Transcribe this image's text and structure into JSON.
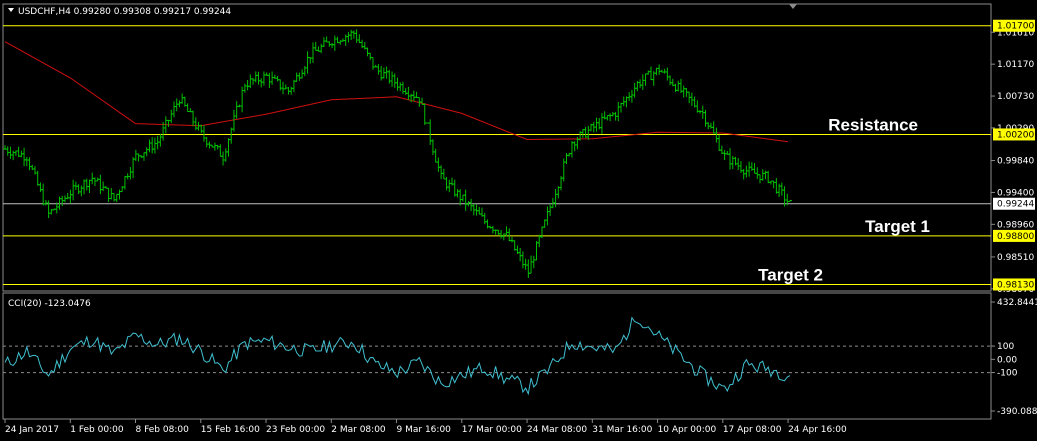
{
  "chart_data": [
    {
      "type": "line",
      "panel": "price",
      "symbol_info": "USDCHF,H4  0.99280 0.99308 0.99217 0.99244",
      "subtype": "bar (OHLC) with moving average",
      "ylim": [
        0.9804,
        1.02
      ],
      "y_ticks": [
        "1.01610",
        "1.01170",
        "1.00730",
        "1.00290",
        "0.99840",
        "0.99400",
        "0.98960",
        "0.98510",
        "0.98070"
      ],
      "series": [
        {
          "name": "",
          "kind": "price",
          "color": "#00c000",
          "x": [
            "24 Jan 2017",
            "26 Jan",
            "28 Jan",
            "1 Feb 00:00",
            "3 Feb",
            "6 Feb",
            "8 Feb 08:00",
            "10 Feb",
            "13 Feb",
            "15 Feb 16:00",
            "17 Feb",
            "20 Feb",
            "23 Feb 00:00",
            "25 Feb",
            "28 Feb",
            "2 Mar 08:00",
            "4 Mar",
            "7 Mar",
            "9 Mar 16:00",
            "11 Mar",
            "14 Mar",
            "17 Mar 00:00",
            "19 Mar",
            "22 Mar",
            "24 Mar 08:00",
            "26 Mar",
            "29 Mar",
            "31 Mar 16:00",
            "3 Apr",
            "6 Apr",
            "10 Apr 00:00",
            "12 Apr",
            "14 Apr",
            "17 Apr 08:00",
            "19 Apr",
            "21 Apr",
            "24 Apr 16:00"
          ],
          "values": [
            1.0,
            0.999,
            0.991,
            0.994,
            0.996,
            0.993,
            0.999,
            1.001,
            1.007,
            1.002,
            0.999,
            1.009,
            1.01,
            1.008,
            1.013,
            1.015,
            1.016,
            1.011,
            1.009,
            1.007,
            0.996,
            0.993,
            0.99,
            0.988,
            0.983,
            0.992,
            1.001,
            1.003,
            1.005,
            1.009,
            1.011,
            1.008,
            1.005,
            0.999,
            0.997,
            0.996,
            0.9924
          ]
        },
        {
          "name": "",
          "kind": "moving average",
          "color": "#d01010",
          "x": [
            "24 Jan 2017",
            "1 Feb 00:00",
            "8 Feb 08:00",
            "15 Feb 16:00",
            "23 Feb 00:00",
            "2 Mar 08:00",
            "9 Mar 16:00",
            "17 Mar 00:00",
            "24 Mar 08:00",
            "31 Mar 16:00",
            "10 Apr 00:00",
            "17 Apr 08:00",
            "24 Apr 16:00"
          ],
          "values": [
            1.0148,
            1.0098,
            1.0035,
            1.0032,
            1.0048,
            1.0068,
            1.0072,
            1.0049,
            1.0013,
            1.0014,
            1.0023,
            1.0022,
            1.001
          ]
        }
      ],
      "horizontal_lines": [
        {
          "label": "1.01700",
          "value": 1.017,
          "color": "#ffff00",
          "boxed": true
        },
        {
          "label": "1.00200",
          "value": 1.002,
          "color": "#ffff00",
          "boxed": true
        },
        {
          "label": "0.98800",
          "value": 0.988,
          "color": "#ffff00",
          "boxed": true
        },
        {
          "label": "0.98130",
          "value": 0.9813,
          "color": "#ffff00",
          "boxed": true
        },
        {
          "label": "0.99244",
          "value": 0.99244,
          "color": "#c0c0c0",
          "boxed": true,
          "current_price": true
        }
      ],
      "annotations": [
        {
          "text": "Resistance",
          "at_value": 1.002,
          "position": "right"
        },
        {
          "text": "Target 1",
          "at_value": 0.988,
          "position": "right"
        },
        {
          "text": "Target 2",
          "at_value": 0.9813,
          "position": "right"
        }
      ],
      "grid": false,
      "background": "#000000"
    },
    {
      "type": "line",
      "panel": "indicator",
      "title": "CCI(20) -123.0476",
      "ylim": [
        -390.0885,
        432.8441
      ],
      "y_ticks": [
        "432.8441",
        "100",
        "0.00",
        "-100",
        "-390.0885"
      ],
      "levels": [
        100,
        -100
      ],
      "series": [
        {
          "name": "",
          "color": "#40c0d0",
          "x": [
            "24 Jan 2017",
            "26 Jan",
            "28 Jan",
            "1 Feb 00:00",
            "3 Feb",
            "6 Feb",
            "8 Feb 08:00",
            "10 Feb",
            "13 Feb",
            "15 Feb 16:00",
            "17 Feb",
            "20 Feb",
            "23 Feb 00:00",
            "25 Feb",
            "28 Feb",
            "2 Mar 08:00",
            "4 Mar",
            "7 Mar",
            "9 Mar 16:00",
            "11 Mar",
            "14 Mar",
            "17 Mar 00:00",
            "19 Mar",
            "22 Mar",
            "24 Mar 08:00",
            "26 Mar",
            "29 Mar",
            "31 Mar 16:00",
            "3 Apr",
            "6 Apr",
            "10 Apr 00:00",
            "12 Apr",
            "14 Apr",
            "17 Apr 08:00",
            "19 Apr",
            "21 Apr",
            "24 Apr 16:00"
          ],
          "values": [
            -40,
            60,
            -120,
            80,
            150,
            40,
            180,
            110,
            160,
            60,
            -80,
            120,
            140,
            90,
            60,
            110,
            130,
            -40,
            -100,
            -20,
            -180,
            -120,
            -60,
            -150,
            -210,
            -70,
            130,
            90,
            60,
            330,
            170,
            20,
            -120,
            -230,
            -40,
            -70,
            -123
          ]
        }
      ],
      "grid": false,
      "background": "#000000"
    }
  ],
  "x_axis_labels": [
    "24 Jan 2017",
    "1 Feb 00:00",
    "8 Feb 08:00",
    "15 Feb 16:00",
    "23 Feb 00:00",
    "2 Mar 08:00",
    "9 Mar 16:00",
    "17 Mar 00:00",
    "24 Mar 08:00",
    "31 Mar 16:00",
    "10 Apr 00:00",
    "17 Apr 08:00",
    "24 Apr 16:00"
  ],
  "colors": {
    "background": "#000000",
    "frame": "#8c8c8c",
    "axis_text": "#ffffff",
    "level_label_bg": "#ffff00",
    "current_price_bg": "#ffffff",
    "dashed_level": "#8c8c8c"
  }
}
